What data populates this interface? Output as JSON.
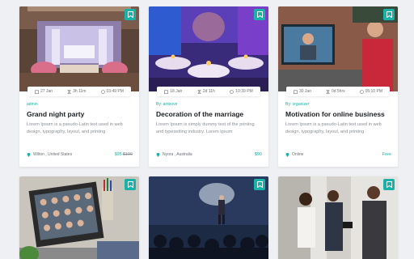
{
  "colors": {
    "accent": "#17b3a8",
    "bookmark_bg": "#17b3a8"
  },
  "cards": [
    {
      "image": "wedding-stage-photo",
      "date": "27 Jan",
      "duration": "3h 11m",
      "time": "03:49 PM",
      "author": "admin",
      "title": "Grand night party",
      "description": "Lorem Ipsum is a pseudo-Latin text used in web design, typography, layout, and printing",
      "location": "Wilton , United States",
      "price": "$95",
      "old_price": "$100"
    },
    {
      "image": "banquet-hall-photo",
      "date": "18 Jan",
      "duration": "2d 11h",
      "time": "10:39 PM",
      "author": "By: ambove",
      "title": "Decoration of the marriage",
      "description": "Lorem Ipsum is simply dummy text of the printing and typesetting industry. Lorem Ipsum",
      "location": "Nyora , Australia",
      "price": "$90",
      "old_price": ""
    },
    {
      "image": "online-meeting-photo",
      "date": "30 Jan",
      "duration": "0d 5hrs",
      "time": "05:10 PM",
      "author": "By: organizer",
      "title": "Motivation for online business",
      "description": "Lorem Ipsum is a pseudo-Latin text used in web design, typography, layout, and printing",
      "location": "Online",
      "price": "Free",
      "old_price": ""
    },
    {
      "image": "video-call-laptop-photo"
    },
    {
      "image": "conference-speaker-photo"
    },
    {
      "image": "business-people-photo"
    }
  ]
}
